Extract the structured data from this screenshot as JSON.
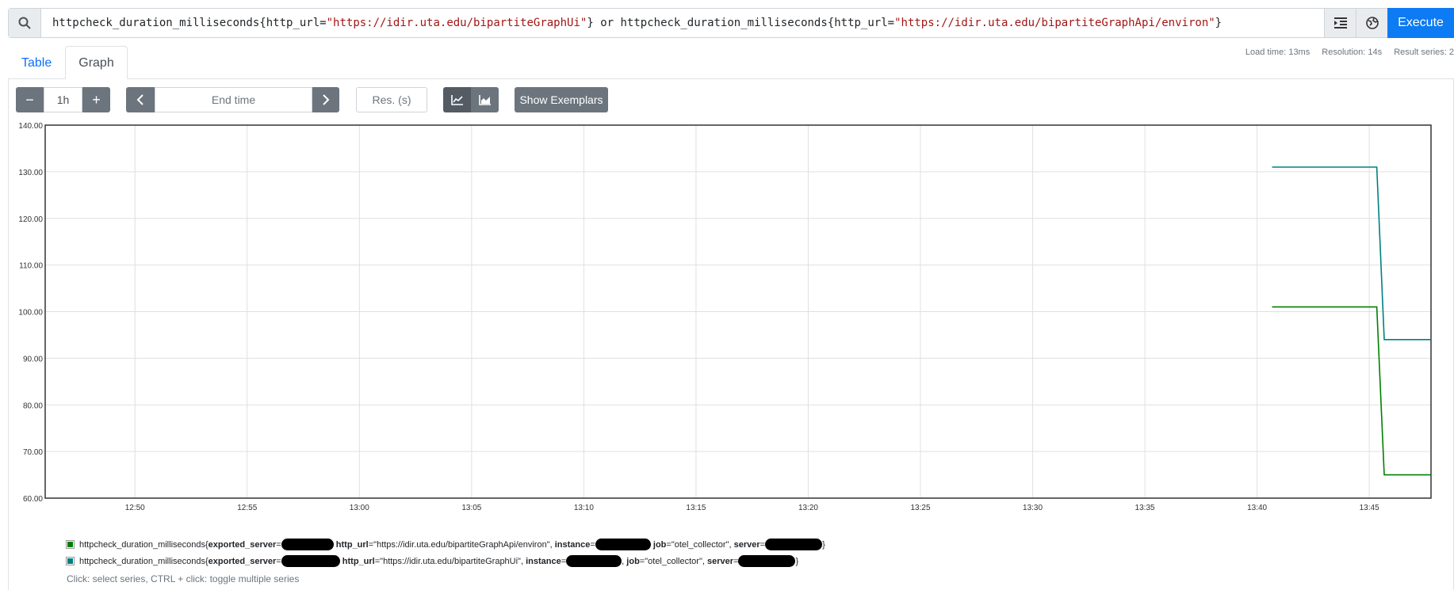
{
  "query": {
    "search_icon": "search-icon",
    "tokens": [
      {
        "t": "httpcheck_duration_milliseconds",
        "c": "q-metric"
      },
      {
        "t": "{",
        "c": "q-punct"
      },
      {
        "t": "http_url",
        "c": "q-label"
      },
      {
        "t": "=",
        "c": "q-punct"
      },
      {
        "t": "\"https://idir.uta.edu/bipartiteGraphUi\"",
        "c": "q-string"
      },
      {
        "t": "} ",
        "c": "q-punct"
      },
      {
        "t": "or",
        "c": "q-op"
      },
      {
        "t": " httpcheck_duration_milliseconds",
        "c": "q-metric"
      },
      {
        "t": "{",
        "c": "q-punct"
      },
      {
        "t": "http_url",
        "c": "q-label"
      },
      {
        "t": "=",
        "c": "q-punct"
      },
      {
        "t": "\"https://idir.uta.edu/bipartiteGraphApi/environ\"",
        "c": "q-string"
      },
      {
        "t": "}",
        "c": "q-punct"
      }
    ],
    "format_icon": "format-indent-icon",
    "metrics_icon": "globe-icon",
    "execute_label": "Execute"
  },
  "stats": {
    "load_time": "Load time: 13ms",
    "resolution": "Resolution: 14s",
    "result_series": "Result series: 2"
  },
  "tabs": [
    {
      "label": "Table",
      "active": false
    },
    {
      "label": "Graph",
      "active": true
    }
  ],
  "toolbar": {
    "minus_label": "−",
    "range_value": "1h",
    "plus_label": "+",
    "end_time_placeholder": "End time",
    "resolution_placeholder": "Res. (s)",
    "show_exemplars_label": "Show Exemplars",
    "line_chart_icon": "line-chart-icon",
    "stacked_chart_icon": "area-chart-icon"
  },
  "colors": {
    "series_environ": "#008000",
    "series_ui": "#008080",
    "grid": "#e0e0e0",
    "axis": "#333333",
    "accent": "#0d7bf3",
    "button_gray": "#6c757d"
  },
  "chart_data": {
    "type": "line",
    "x_ticks": [
      "12:50",
      "12:55",
      "13:00",
      "13:05",
      "13:10",
      "13:15",
      "13:20",
      "13:25",
      "13:30",
      "13:35",
      "13:40",
      "13:45"
    ],
    "y_ticks": [
      "60.00",
      "70.00",
      "80.00",
      "90.00",
      "100.00",
      "110.00",
      "120.00",
      "130.00",
      "140.00"
    ],
    "xlim": [
      "12:46",
      "13:47:45"
    ],
    "ylim": [
      60,
      140
    ],
    "grid": true,
    "legend_position": "bottom",
    "series": [
      {
        "name_bold_key": "exported_server",
        "x": [
          "13:40:40",
          "13:45:20",
          "13:45:40",
          "13:47:45"
        ],
        "y": [
          101,
          101,
          65,
          65
        ]
      },
      {
        "name_bold_key": "exported_server",
        "x": [
          "13:40:40",
          "13:45:20",
          "13:45:40",
          "13:47:45"
        ],
        "y": [
          131,
          131,
          94,
          94
        ]
      }
    ]
  },
  "legend": [
    {
      "metric": "httpcheck_duration_milliseconds",
      "open": "{",
      "k1": "exported_server",
      "eq": "=",
      "k2": "http_url",
      "v2": "\"https://idir.uta.edu/bipartiteGraphApi/environ\"",
      "k3": "instance",
      "k4": "job",
      "v4": "\"otel_collector\"",
      "k5": "server",
      "close": "}"
    },
    {
      "metric": "httpcheck_duration_milliseconds",
      "open": "{",
      "k1": "exported_server",
      "eq": "=",
      "k2": "http_url",
      "v2": "\"https://idir.uta.edu/bipartiteGraphUi\"",
      "k3": "instance",
      "k4": "job",
      "v4": "\"otel_collector\"",
      "k5": "server",
      "close": "}"
    }
  ],
  "legend_hint": "Click: select series, CTRL + click: toggle multiple series"
}
